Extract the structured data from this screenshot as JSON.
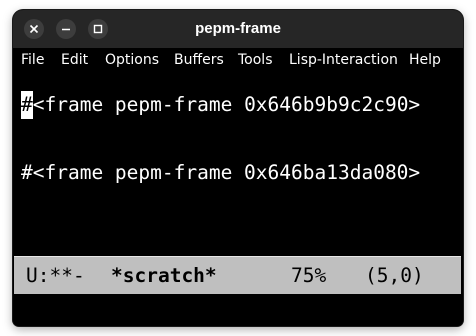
{
  "window": {
    "title": "pepm-frame"
  },
  "menubar": {
    "items": [
      "File",
      "Edit",
      "Options",
      "Buffers",
      "Tools",
      "Lisp-Interaction",
      "Help"
    ]
  },
  "buffer": {
    "cursor_char": "#",
    "line1_rest": "<frame pepm-frame 0x646b9b9c2c90>",
    "line2": "#<frame pepm-frame 0x646ba13da080>"
  },
  "modeline": {
    "status": "U:**-",
    "buffer_name": "*scratch*",
    "percent": "75%",
    "position": "(5,0)"
  },
  "colors": {
    "background": "#000000",
    "foreground": "#ffffff",
    "modeline_bg": "#bfbfbf",
    "titlebar_bg": "#262626"
  },
  "icons": {
    "close": "close-icon",
    "minimize": "minimize-icon",
    "maximize": "maximize-icon"
  }
}
